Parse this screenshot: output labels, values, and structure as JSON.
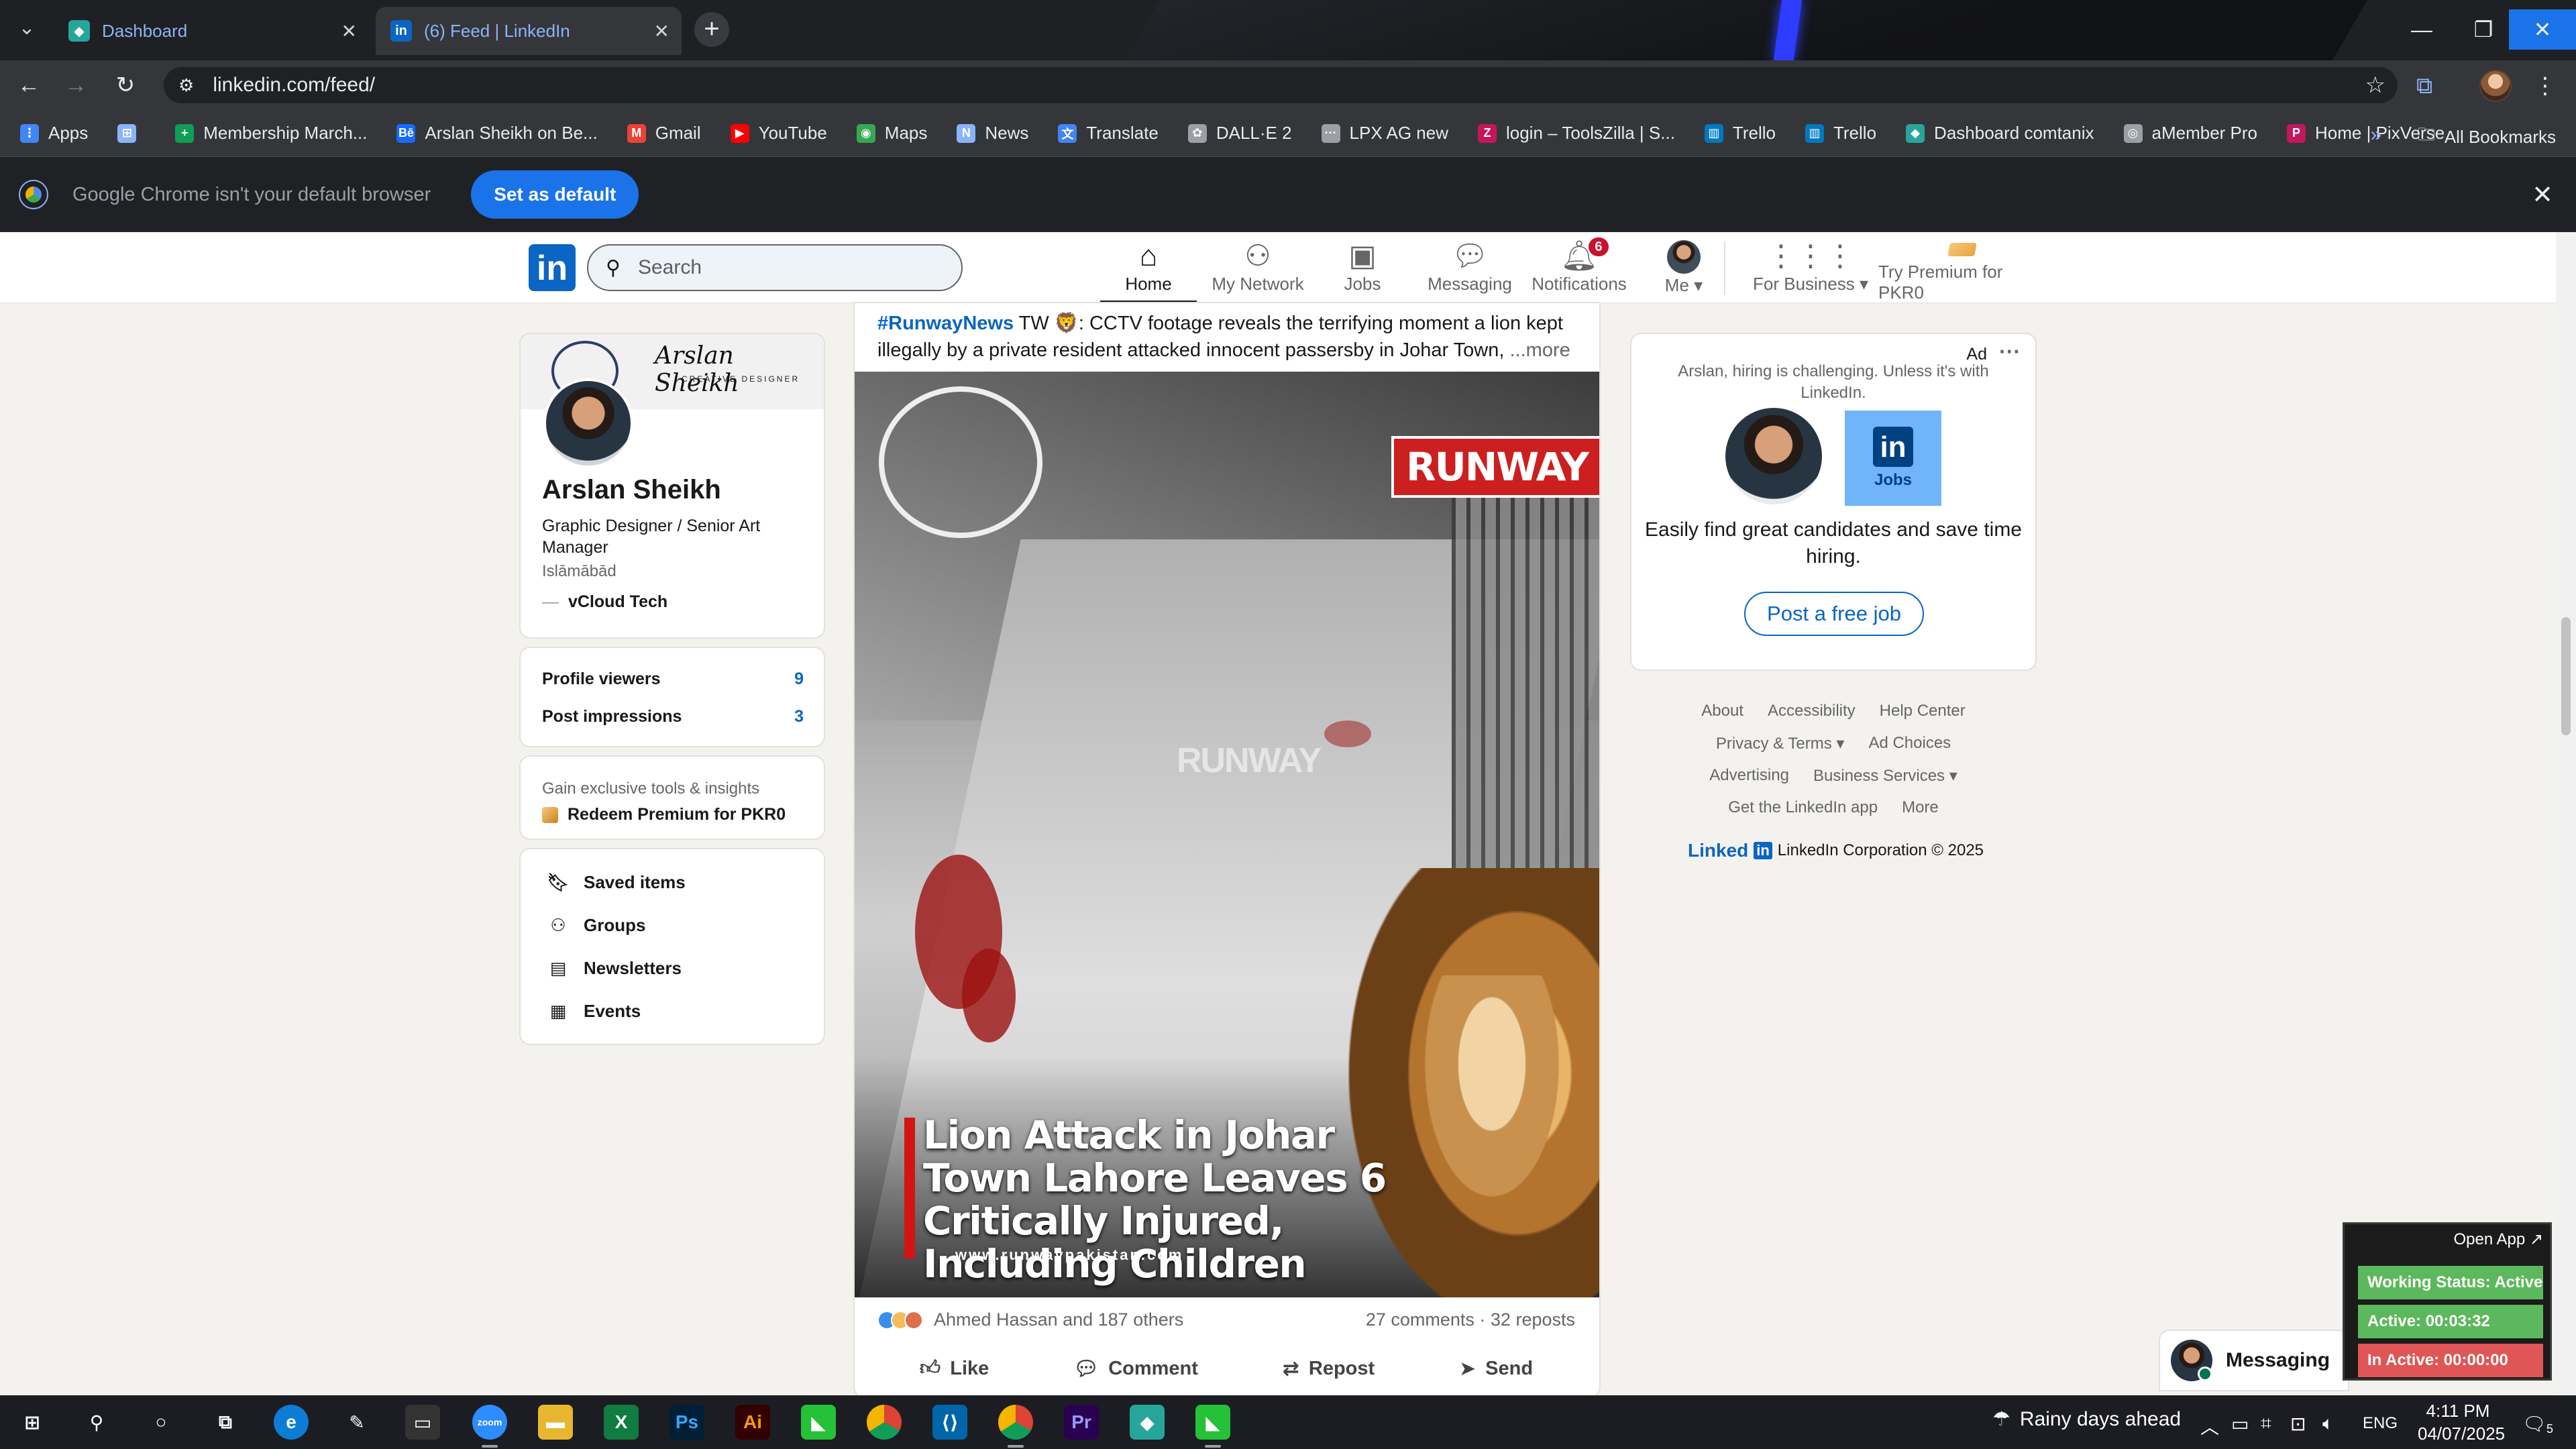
{
  "browser": {
    "tabs": [
      {
        "label": "Dashboard",
        "active": false
      },
      {
        "label": "(6) Feed | LinkedIn",
        "active": true
      }
    ],
    "url": "linkedin.com/feed/",
    "bookmarks": [
      {
        "label": "Apps",
        "icon": "apps-grid-icon",
        "color": "#4285f4"
      },
      {
        "label": "",
        "icon": "grid-icon",
        "color": "#8ab4f8"
      },
      {
        "label": "Membership March...",
        "icon": "plus-icon",
        "color": "#0f9d58"
      },
      {
        "label": "Arslan Sheikh on Be...",
        "icon": "behance-icon",
        "color": "#1769ff"
      },
      {
        "label": "Gmail",
        "icon": "gmail-icon",
        "color": "#ea4335"
      },
      {
        "label": "YouTube",
        "icon": "youtube-icon",
        "color": "#ff0000"
      },
      {
        "label": "Maps",
        "icon": "maps-icon",
        "color": "#34a853"
      },
      {
        "label": "News",
        "icon": "news-icon",
        "color": "#8ab4f8"
      },
      {
        "label": "Translate",
        "icon": "translate-icon",
        "color": "#4285f4"
      },
      {
        "label": "DALL·E 2",
        "icon": "openai-icon",
        "color": "#9aa0a6"
      },
      {
        "label": "LPX AG new",
        "icon": "dots-icon",
        "color": "#9aa0a6"
      },
      {
        "label": "login – ToolsZilla | S...",
        "icon": "toolszilla-icon",
        "color": "#c2185b"
      },
      {
        "label": "Trello",
        "icon": "trello-icon",
        "color": "#0079bf"
      },
      {
        "label": "Trello",
        "icon": "trello-icon",
        "color": "#0079bf"
      },
      {
        "label": "Dashboard comtanix",
        "icon": "comtanix-icon",
        "color": "#26a69a"
      },
      {
        "label": "aMember Pro",
        "icon": "amember-icon",
        "color": "#9aa0a6"
      },
      {
        "label": "Home | PixVerse",
        "icon": "pixverse-icon",
        "color": "#c2185b"
      }
    ],
    "all_bookmarks": "All Bookmarks",
    "default_bar": {
      "message": "Google Chrome isn't your default browser",
      "button": "Set as default"
    }
  },
  "linkedin": {
    "search_placeholder": "Search",
    "nav": [
      {
        "label": "Home",
        "icon": "home-icon",
        "active": true
      },
      {
        "label": "My Network",
        "icon": "network-icon"
      },
      {
        "label": "Jobs",
        "icon": "briefcase-icon"
      },
      {
        "label": "Messaging",
        "icon": "chat-icon"
      },
      {
        "label": "Notifications",
        "icon": "bell-icon",
        "badge": "6"
      },
      {
        "label": "Me ▾",
        "icon": "avatar"
      },
      {
        "label": "For Business ▾",
        "icon": "apps-grid-icon"
      },
      {
        "label": "Try Premium for PKR0",
        "icon": "premium-icon"
      }
    ],
    "profile": {
      "name": "Arslan Sheikh",
      "headline": "Graphic Designer / Senior Art Manager",
      "location": "Islāmābād",
      "company": "vCloud Tech",
      "cover_signature": "Arslan Sheikh",
      "cover_subtitle": "CREATIVE DESIGNER"
    },
    "stats": [
      {
        "label": "Profile viewers",
        "value": "9"
      },
      {
        "label": "Post impressions",
        "value": "3"
      }
    ],
    "premium": {
      "text": "Gain exclusive tools & insights",
      "link": "Redeem Premium for PKR0"
    },
    "side_links": [
      {
        "label": "Saved items",
        "icon": "bookmark-icon"
      },
      {
        "label": "Groups",
        "icon": "groups-icon"
      },
      {
        "label": "Newsletters",
        "icon": "newsletter-icon"
      },
      {
        "label": "Events",
        "icon": "calendar-icon"
      }
    ],
    "post": {
      "hashtag": "#RunwayNews",
      "text": " TW 🦁: CCTV footage reveals the terrifying moment a lion kept illegally by a private resident attacked innocent passersby in Johar Town, ",
      "more": "...more",
      "media_logo": "RUNWAY",
      "media_watermark": "RUNWAY",
      "media_title": "Lion Attack in Johar Town Lahore Leaves 6 Critically Injured, Including Children",
      "media_url": "www.runwaypakistan.com",
      "reactions_text": "Ahmed Hassan and 187 others",
      "comments_reposts": "27 comments · 32 reposts",
      "actions": [
        {
          "label": "Like",
          "icon": "like-icon"
        },
        {
          "label": "Comment",
          "icon": "comment-icon"
        },
        {
          "label": "Repost",
          "icon": "repost-icon"
        },
        {
          "label": "Send",
          "icon": "send-icon"
        }
      ]
    },
    "ad": {
      "label": "Ad",
      "line": "Arslan, hiring is challenging. Unless it's with LinkedIn.",
      "jobs_label": "Jobs",
      "description": "Easily find great candidates and save time hiring.",
      "button": "Post a free job"
    },
    "footer": {
      "rows": [
        [
          "About",
          "Accessibility",
          "Help Center"
        ],
        [
          "Privacy & Terms ▾",
          "Ad Choices"
        ],
        [
          "Advertising",
          "Business Services ▾"
        ],
        [
          "Get the LinkedIn app",
          "More"
        ]
      ],
      "brand": "Linked",
      "brand_in": "in",
      "copyright": "LinkedIn Corporation © 2025"
    },
    "messaging": "Messaging"
  },
  "tracker": {
    "open": "Open App ↗",
    "working": "Working Status: Active",
    "active": "Active: 00:03:32",
    "inactive": "In Active: 00:00:00",
    "colors": {
      "working": "#5cb85c",
      "active": "#5cb85c",
      "inactive": "#e05555"
    }
  },
  "taskbar": {
    "weather": "Rainy days ahead",
    "lang": "ENG",
    "time": "4:11 PM",
    "date": "04/07/2025",
    "notifications": "5"
  }
}
